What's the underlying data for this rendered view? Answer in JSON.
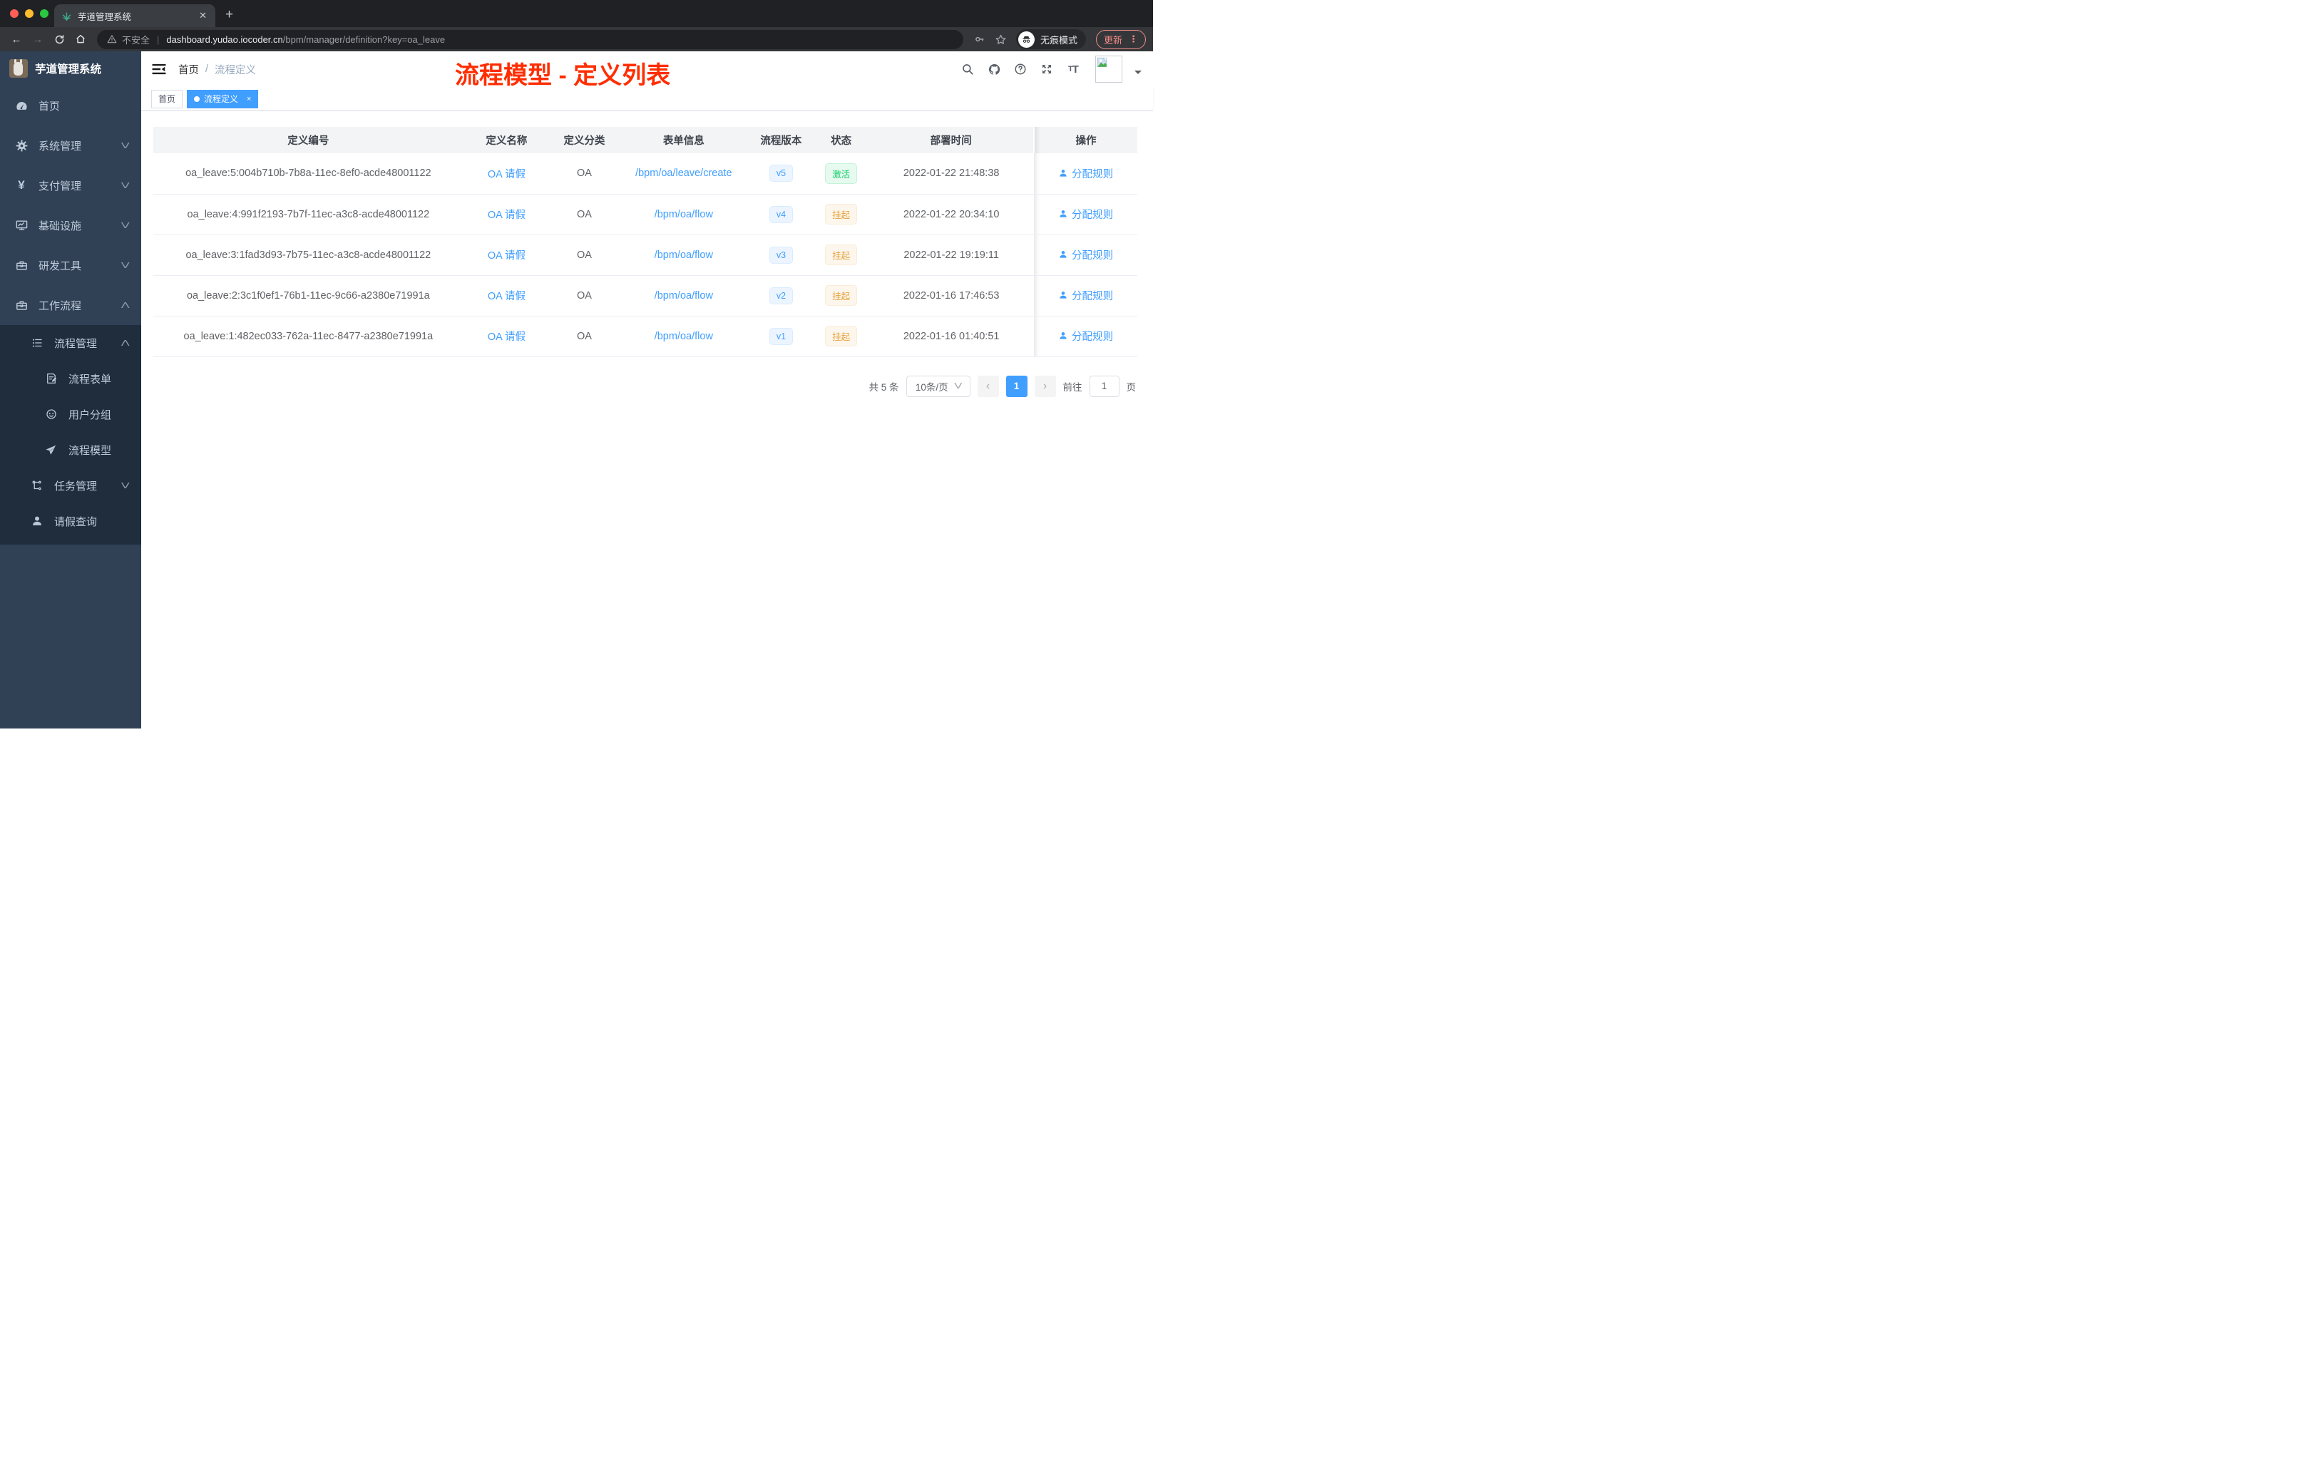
{
  "browser": {
    "tab_title": "芋道管理系统",
    "security_label": "不安全",
    "url_host": "dashboard.yudao.iocoder.cn",
    "url_path": "/bpm/manager/definition?key=oa_leave",
    "incognito_label": "无痕模式",
    "update_label": "更新"
  },
  "sidebar": {
    "app_title": "芋道管理系统",
    "menu": {
      "home": "首页",
      "system": "系统管理",
      "pay": "支付管理",
      "infra": "基础设施",
      "devtools": "研发工具",
      "workflow": "工作流程",
      "process_mgmt": "流程管理",
      "process_form": "流程表单",
      "user_group": "用户分组",
      "process_model": "流程模型",
      "task_mgmt": "任务管理",
      "leave_query": "请假查询"
    }
  },
  "header": {
    "breadcrumb_home": "首页",
    "breadcrumb_sep": "/",
    "breadcrumb_current": "流程定义",
    "annotation": "流程模型 - 定义列表"
  },
  "tags": {
    "home": "首页",
    "active": "流程定义",
    "close": "×"
  },
  "table": {
    "columns": {
      "id": "定义编号",
      "name": "定义名称",
      "category": "定义分类",
      "form": "表单信息",
      "version": "流程版本",
      "status": "状态",
      "deploy_time": "部署时间",
      "actions": "操作"
    },
    "rows": [
      {
        "id": "oa_leave:5:004b710b-7b8a-11ec-8ef0-acde48001122",
        "name": "OA 请假",
        "category": "OA",
        "form": "/bpm/oa/leave/create",
        "version": "v5",
        "status": "激活",
        "status_type": "success",
        "deploy_time": "2022-01-22 21:48:38",
        "action": "分配规则"
      },
      {
        "id": "oa_leave:4:991f2193-7b7f-11ec-a3c8-acde48001122",
        "name": "OA 请假",
        "category": "OA",
        "form": "/bpm/oa/flow",
        "version": "v4",
        "status": "挂起",
        "status_type": "warning",
        "deploy_time": "2022-01-22 20:34:10",
        "action": "分配规则"
      },
      {
        "id": "oa_leave:3:1fad3d93-7b75-11ec-a3c8-acde48001122",
        "name": "OA 请假",
        "category": "OA",
        "form": "/bpm/oa/flow",
        "version": "v3",
        "status": "挂起",
        "status_type": "warning",
        "deploy_time": "2022-01-22 19:19:11",
        "action": "分配规则"
      },
      {
        "id": "oa_leave:2:3c1f0ef1-76b1-11ec-9c66-a2380e71991a",
        "name": "OA 请假",
        "category": "OA",
        "form": "/bpm/oa/flow",
        "version": "v2",
        "status": "挂起",
        "status_type": "warning",
        "deploy_time": "2022-01-16 17:46:53",
        "action": "分配规则"
      },
      {
        "id": "oa_leave:1:482ec033-762a-11ec-8477-a2380e71991a",
        "name": "OA 请假",
        "category": "OA",
        "form": "/bpm/oa/flow",
        "version": "v1",
        "status": "挂起",
        "status_type": "warning",
        "deploy_time": "2022-01-16 01:40:51",
        "action": "分配规则"
      }
    ]
  },
  "pagination": {
    "total": "共 5 条",
    "page_size": "10条/页",
    "current_page": "1",
    "goto_label": "前往",
    "goto_value": "1",
    "page_unit": "页"
  },
  "colors": {
    "accent": "#409eff",
    "sidebar_bg": "#304156",
    "submenu_bg": "#1f2d3d",
    "success": "#13ce66",
    "warning": "#e6a23c",
    "annotation_red": "#ff2d00"
  }
}
